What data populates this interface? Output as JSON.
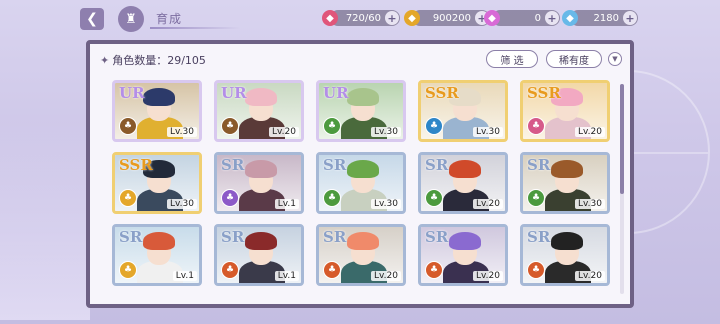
{
  "header": {
    "title": "育成"
  },
  "currencies": [
    {
      "icon": "candy-icon",
      "value": "720/60",
      "color": "#e0567a"
    },
    {
      "icon": "gold-coin-icon",
      "value": "900200",
      "color": "#e4a72a"
    },
    {
      "icon": "pink-gem-icon",
      "value": "0",
      "color": "#d86ad6"
    },
    {
      "icon": "blue-diamond-icon",
      "value": "2180",
      "color": "#68b9e8"
    }
  ],
  "panel": {
    "count_label": "角色数量：29/105",
    "filter_label": "筛 选",
    "rarity_label": "稀有度"
  },
  "characters": [
    {
      "rarity": "UR",
      "level": "Lv.30",
      "element": "#8a5a2a",
      "hair": "#2c3a6a",
      "outfit": "#e0b030",
      "bg": "#d6c4a6"
    },
    {
      "rarity": "UR",
      "level": "Lv.20",
      "element": "#8a5a2a",
      "hair": "#f0b9c4",
      "outfit": "#5a3a38",
      "bg": "#c9d9c2"
    },
    {
      "rarity": "UR",
      "level": "Lv.30",
      "element": "#4c9a3e",
      "hair": "#a8c48c",
      "outfit": "#4a6a3c",
      "bg": "#b9d4b0"
    },
    {
      "rarity": "SSR",
      "level": "Lv.30",
      "element": "#2e86c8",
      "hair": "#e6dcc8",
      "outfit": "#9ab4d0",
      "bg": "#e9d9b9"
    },
    {
      "rarity": "SSR",
      "level": "Lv.20",
      "element": "#d65a8a",
      "hair": "#f2a9c2",
      "outfit": "#e4c2cc",
      "bg": "#f2d8a8"
    },
    {
      "rarity": "SSR",
      "level": "Lv.30",
      "element": "#e4a72a",
      "hair": "#222a3a",
      "outfit": "#3a4a5e",
      "bg": "#c4d4e2"
    },
    {
      "rarity": "SR",
      "level": "Lv.1",
      "element": "#8c5ac8",
      "hair": "#c89aa8",
      "outfit": "#5a3a48",
      "bg": "#c8b8c8"
    },
    {
      "rarity": "SR",
      "level": "Lv.30",
      "element": "#4c9a3e",
      "hair": "#6aa84a",
      "outfit": "#c8d0c0",
      "bg": "#c6d8e8"
    },
    {
      "rarity": "SR",
      "level": "Lv.20",
      "element": "#4c9a3e",
      "hair": "#d04a2a",
      "outfit": "#2a2a3a",
      "bg": "#d2d2da"
    },
    {
      "rarity": "SR",
      "level": "Lv.30",
      "element": "#4c9a3e",
      "hair": "#9a5a2a",
      "outfit": "#3a4030",
      "bg": "#d8d0c0"
    },
    {
      "rarity": "SR",
      "level": "Lv.1",
      "element": "#e4a72a",
      "hair": "#d85a3a",
      "outfit": "#f0f0f0",
      "bg": "#c8dcea"
    },
    {
      "rarity": "SR",
      "level": "Lv.1",
      "element": "#d65a2a",
      "hair": "#8a2a2a",
      "outfit": "#3a3a4a",
      "bg": "#c6d2e0"
    },
    {
      "rarity": "SR",
      "level": "Lv.20",
      "element": "#d65a2a",
      "hair": "#f08a6a",
      "outfit": "#3a6a6a",
      "bg": "#d6d0c8"
    },
    {
      "rarity": "SR",
      "level": "Lv.20",
      "element": "#d65a2a",
      "hair": "#8a6ad0",
      "outfit": "#3a3050",
      "bg": "#d0c8de"
    },
    {
      "rarity": "SR",
      "level": "Lv.20",
      "element": "#d65a2a",
      "hair": "#222222",
      "outfit": "#2a2a2a",
      "bg": "#d6dae2"
    }
  ]
}
